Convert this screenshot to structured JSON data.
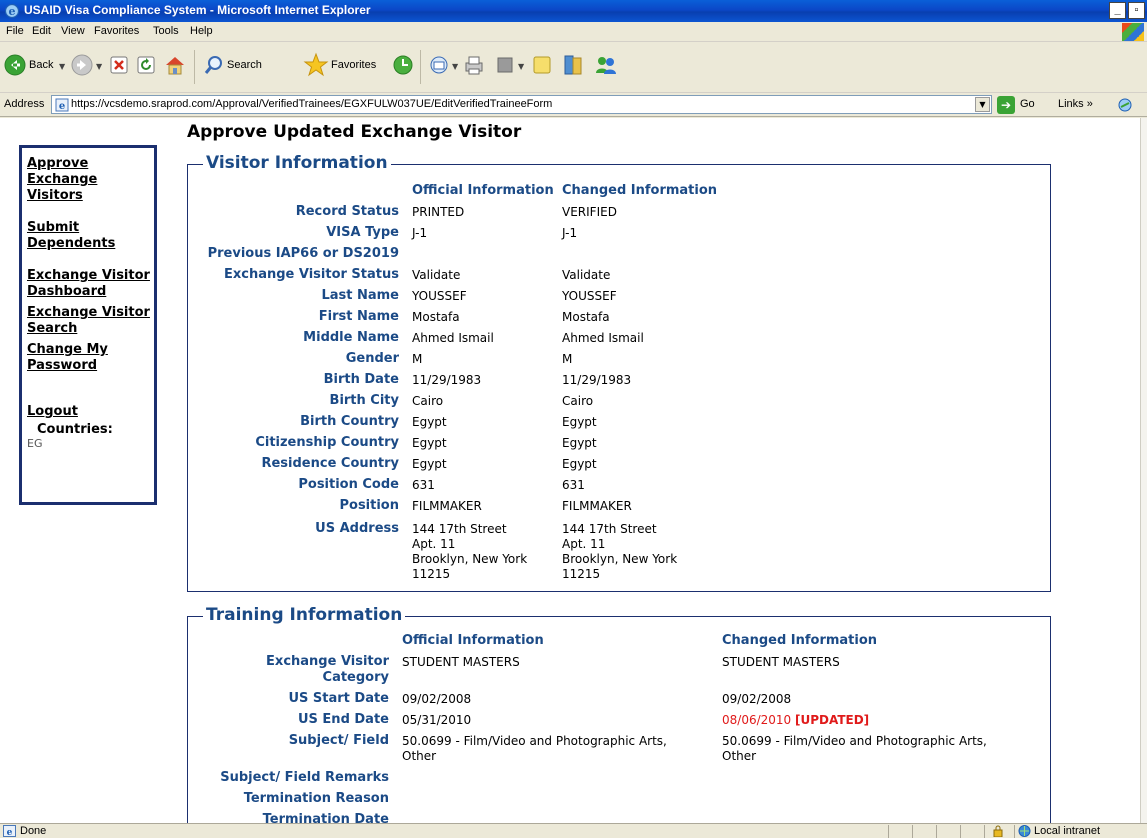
{
  "window": {
    "title": "USAID Visa Compliance System - Microsoft Internet Explorer",
    "minimize": "_",
    "maximize": "▫"
  },
  "menu": [
    "File",
    "Edit",
    "View",
    "Favorites",
    "Tools",
    "Help"
  ],
  "toolbar": {
    "back_label": "Back",
    "search_label": "Search",
    "favorites_label": "Favorites"
  },
  "address": {
    "label": "Address",
    "url": "https://vcsdemo.sraprod.com/Approval/VerifiedTrainees/EGXFULW037UE/EditVerifiedTraineeForm",
    "go_label": "Go",
    "links_label": "Links"
  },
  "colors": {
    "heading_blue": "#1b4a86",
    "border_navy": "#1b2f6f",
    "updated_red": "#e01a1a"
  },
  "sidebar": {
    "items": [
      {
        "label": "Approve Exchange Visitors"
      },
      {
        "label": "Submit Dependents"
      },
      {
        "label": "Exchange Visitor Dashboard"
      },
      {
        "label": "Exchange Visitor Search"
      },
      {
        "label": "Change My Password"
      },
      {
        "label": "Logout"
      }
    ],
    "countries_label": "Countries:",
    "countries_value": "EG"
  },
  "page": {
    "title": "Approve Updated Exchange Visitor"
  },
  "visitor": {
    "legend": "Visitor Information",
    "col_official": "Official Information",
    "col_changed": "Changed Information",
    "rows": [
      {
        "label": "Record Status",
        "official": "PRINTED",
        "changed": "VERIFIED"
      },
      {
        "label": "VISA Type",
        "official": "J-1",
        "changed": "J-1"
      },
      {
        "label": "Previous IAP66 or DS2019",
        "official": "",
        "changed": ""
      },
      {
        "label": "Exchange Visitor Status",
        "official": "Validate",
        "changed": "Validate"
      },
      {
        "label": "Last Name",
        "official": "YOUSSEF",
        "changed": "YOUSSEF"
      },
      {
        "label": "First Name",
        "official": "Mostafa",
        "changed": "Mostafa"
      },
      {
        "label": "Middle Name",
        "official": "Ahmed Ismail",
        "changed": "Ahmed Ismail"
      },
      {
        "label": "Gender",
        "official": "M",
        "changed": "M"
      },
      {
        "label": "Birth Date",
        "official": "11/29/1983",
        "changed": "11/29/1983"
      },
      {
        "label": "Birth City",
        "official": "Cairo",
        "changed": "Cairo"
      },
      {
        "label": "Birth Country",
        "official": "Egypt",
        "changed": "Egypt"
      },
      {
        "label": "Citizenship Country",
        "official": "Egypt",
        "changed": "Egypt"
      },
      {
        "label": "Residence Country",
        "official": "Egypt",
        "changed": "Egypt"
      },
      {
        "label": "Position Code",
        "official": "631",
        "changed": "631"
      },
      {
        "label": "Position",
        "official": "FILMMAKER",
        "changed": "FILMMAKER"
      }
    ],
    "us_address": {
      "label": "US Address",
      "official_lines": [
        "144 17th Street",
        "Apt. 11",
        "Brooklyn, New York",
        "11215"
      ],
      "changed_lines": [
        "144 17th Street",
        "Apt. 11",
        "Brooklyn, New York",
        "11215"
      ]
    }
  },
  "training": {
    "legend": "Training Information",
    "col_official": "Official Information",
    "col_changed": "Changed Information",
    "category_label_1": "Exchange Visitor",
    "category_label_2": "Category",
    "category_official": "STUDENT MASTERS",
    "category_changed": "STUDENT MASTERS",
    "start_label": "US Start Date",
    "start_official": "09/02/2008",
    "start_changed": "09/02/2008",
    "end_label": "US End Date",
    "end_official": "05/31/2010",
    "end_changed": "08/06/2010",
    "updated_tag": "[UPDATED]",
    "subject_label": "Subject/ Field",
    "subject_official_1": "50.0699 - Film/Video and Photographic Arts,",
    "subject_official_2": "Other",
    "subject_changed_1": "50.0699 - Film/Video and Photographic Arts,",
    "subject_changed_2": "Other",
    "remarks_label": "Subject/ Field Remarks",
    "termination_reason_label": "Termination Reason",
    "termination_date_label": "Termination Date"
  },
  "status": {
    "text": "Done",
    "zone": "Local intranet"
  }
}
